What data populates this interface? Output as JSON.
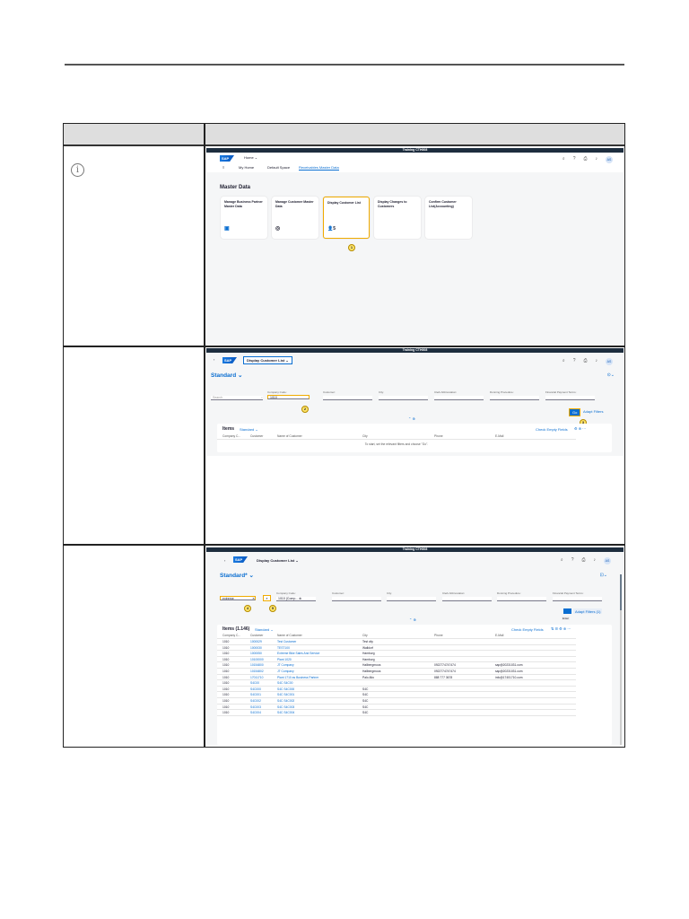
{
  "shell_title": "Training  CTH008",
  "avatar": "AS",
  "step1": {
    "home_menu": "Home ⌄",
    "tabs": [
      "My Home",
      "Default Space",
      "Receivables Master Data"
    ],
    "section": "Master Data",
    "tiles": [
      {
        "title": "Manage Business Partner Master Data",
        "icon": "▣"
      },
      {
        "title": "Manage Customer Master Data",
        "icon": "◎"
      },
      {
        "title": "Display Customer List",
        "icon": "👤",
        "count": "5"
      },
      {
        "title": "Display Changes to Customers",
        "icon": ""
      },
      {
        "title": "Confirm Customer List(Accounting)",
        "icon": ""
      }
    ],
    "callout": "1"
  },
  "step2": {
    "app_title": "Display Customer List ⌄",
    "variant": "Standard ⌄",
    "search_placeholder": "Search",
    "filters": [
      "Company Code:",
      "Customer:",
      "City:",
      "Clerk Abbreviation:",
      "Dunning Procedure:",
      "Financial Payment Terms:"
    ],
    "company_code_value": "1010",
    "go": "Go",
    "adapt": "Adapt Filters",
    "items_title": "Items",
    "items_variant": "Standard ⌄",
    "check_empty": "Check Empty Fields",
    "columns": [
      "Company C...",
      "Customer",
      "Name of Customer",
      "City",
      "Phone",
      "E-Mail"
    ],
    "empty_msg": "To start, set the relevant filters and choose \"Go\".",
    "callouts": [
      "2",
      "3"
    ]
  },
  "step3": {
    "app_title": "Display Customer List ⌄",
    "variant": "Standard* ⌄",
    "search_value": "extreme",
    "company_code_value": "1010 (Comp... ⊗",
    "adapt": "Adapt Filters (1)",
    "go_tooltip": "Enter",
    "items_title": "Items (1.146)",
    "callouts": [
      "4",
      "5"
    ],
    "rows": [
      [
        "1010",
        "1000029",
        "Test Customer",
        "Test city",
        "",
        ""
      ],
      [
        "1010",
        "1000030",
        "TEST100",
        "Walldorf",
        "",
        ""
      ],
      [
        "1010",
        "1000050",
        "Extreme Bike Sales And Service",
        "Hamburg",
        "",
        ""
      ],
      [
        "1010",
        "10100000",
        "Plant 1020",
        "Hamburg",
        "",
        ""
      ],
      [
        "1010",
        "10154800",
        "JT Company",
        "Hallbergmoos",
        "0922774747474",
        "sap@20231031.com"
      ],
      [
        "1010",
        "10154802",
        "JT Company",
        "Hallbergmoos",
        "0922774747474",
        "sap@20231031.com"
      ],
      [
        "1010",
        "17011710",
        "Plant 1710 as Business Partner",
        "Palo Alto",
        "888 777 3678",
        "info@17401710.com"
      ],
      [
        "1010",
        "S4C00",
        "S4C S4C00",
        "",
        "",
        ""
      ],
      [
        "1010",
        "S4C000",
        "S4C S4C000",
        "S4C",
        "",
        ""
      ],
      [
        "1010",
        "S4C001",
        "S4C S4C001",
        "S4C",
        "",
        ""
      ],
      [
        "1010",
        "S4C002",
        "S4C S4C002",
        "S4C",
        "",
        ""
      ],
      [
        "1010",
        "S4C003",
        "S4C S4C003",
        "S4C",
        "",
        ""
      ],
      [
        "1010",
        "S4C004",
        "S4C S4C004",
        "S4C",
        "",
        ""
      ]
    ]
  }
}
